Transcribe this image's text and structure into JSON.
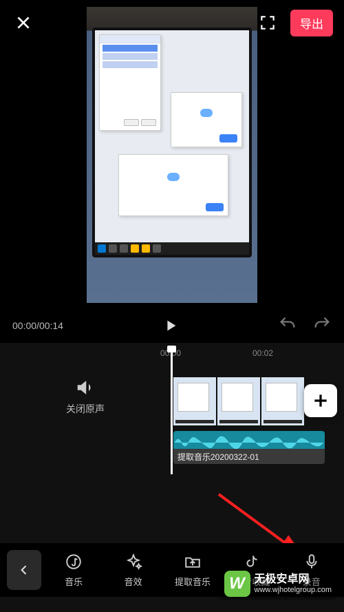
{
  "export_label": "导出",
  "time": {
    "current": "00:00",
    "total": "00:14"
  },
  "ruler": {
    "t0": "00:00",
    "t1": "00:02"
  },
  "mute_label": "关闭原声",
  "audio_clip_name": "提取音乐20200322-01",
  "toolbar": {
    "music": "音乐",
    "sound_effect": "音效",
    "extract_audio": "提取音乐",
    "douyin": "抖音收藏",
    "record": "录音"
  },
  "watermark": {
    "logo": "W",
    "name": "无极安卓网",
    "domain": "www.wjhotelgroup.com"
  }
}
